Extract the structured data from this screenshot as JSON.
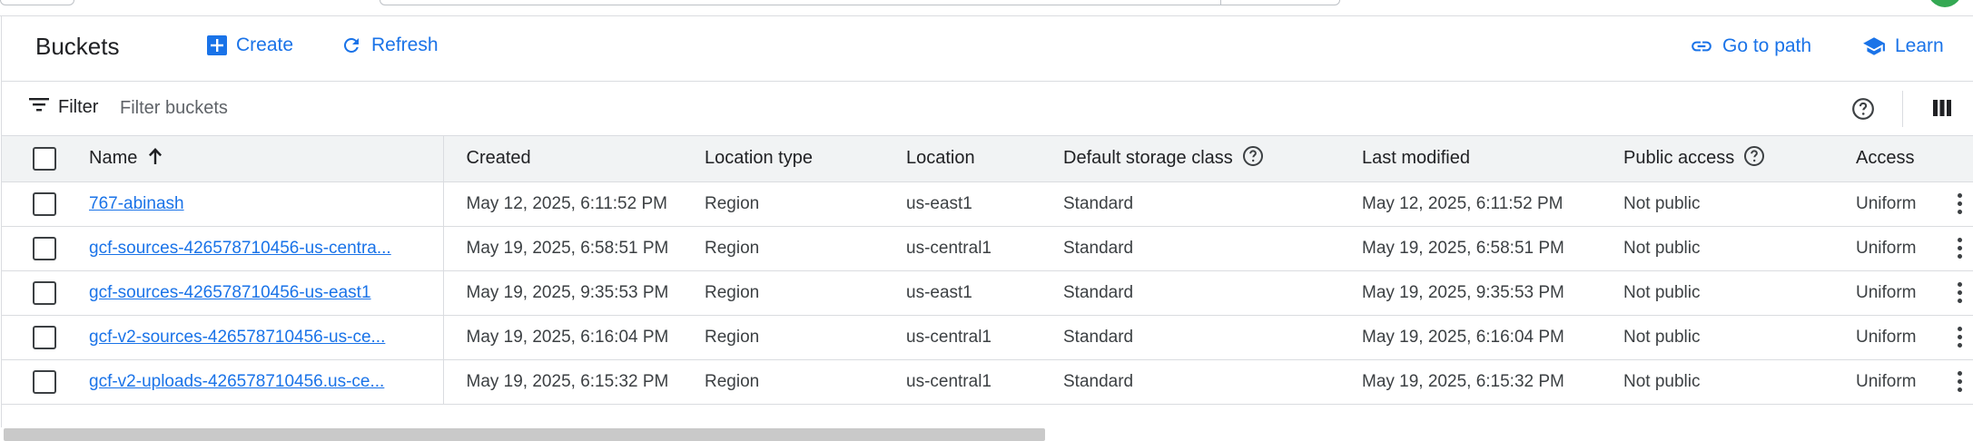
{
  "toolbar": {
    "title": "Buckets",
    "create_label": "Create",
    "refresh_label": "Refresh",
    "go_to_path_label": "Go to path",
    "learn_label": "Learn"
  },
  "filter": {
    "label": "Filter",
    "placeholder": "Filter buckets"
  },
  "table": {
    "columns": [
      "Name",
      "Created",
      "Location type",
      "Location",
      "Default storage class",
      "Last modified",
      "Public access",
      "Access"
    ],
    "rows": [
      {
        "name": "767-abinash",
        "created": "May 12, 2025, 6:11:52 PM",
        "location_type": "Region",
        "location": "us-east1",
        "storage_class": "Standard",
        "last_modified": "May 12, 2025, 6:11:52 PM",
        "public_access": "Not public",
        "access": "Uniform"
      },
      {
        "name": "gcf-sources-426578710456-us-centra...",
        "created": "May 19, 2025, 6:58:51 PM",
        "location_type": "Region",
        "location": "us-central1",
        "storage_class": "Standard",
        "last_modified": "May 19, 2025, 6:58:51 PM",
        "public_access": "Not public",
        "access": "Uniform"
      },
      {
        "name": "gcf-sources-426578710456-us-east1",
        "created": "May 19, 2025, 9:35:53 PM",
        "location_type": "Region",
        "location": "us-east1",
        "storage_class": "Standard",
        "last_modified": "May 19, 2025, 9:35:53 PM",
        "public_access": "Not public",
        "access": "Uniform"
      },
      {
        "name": "gcf-v2-sources-426578710456-us-ce...",
        "created": "May 19, 2025, 6:16:04 PM",
        "location_type": "Region",
        "location": "us-central1",
        "storage_class": "Standard",
        "last_modified": "May 19, 2025, 6:16:04 PM",
        "public_access": "Not public",
        "access": "Uniform"
      },
      {
        "name": "gcf-v2-uploads-426578710456.us-ce...",
        "created": "May 19, 2025, 6:15:32 PM",
        "location_type": "Region",
        "location": "us-central1",
        "storage_class": "Standard",
        "last_modified": "May 19, 2025, 6:15:32 PM",
        "public_access": "Not public",
        "access": "Uniform"
      }
    ]
  },
  "colors": {
    "accent": "#1a73e8",
    "header_bg": "#f1f3f4",
    "border": "#dadce0",
    "text": "#202124"
  },
  "icons": {
    "create": "add-box-icon",
    "refresh": "refresh-icon",
    "go_to_path": "link-icon",
    "learn": "school-icon",
    "filter": "filter-icon",
    "help": "help-icon",
    "columns": "column-display-icon",
    "sort": "arrow-up-icon",
    "row_menu": "more-vert-icon"
  }
}
